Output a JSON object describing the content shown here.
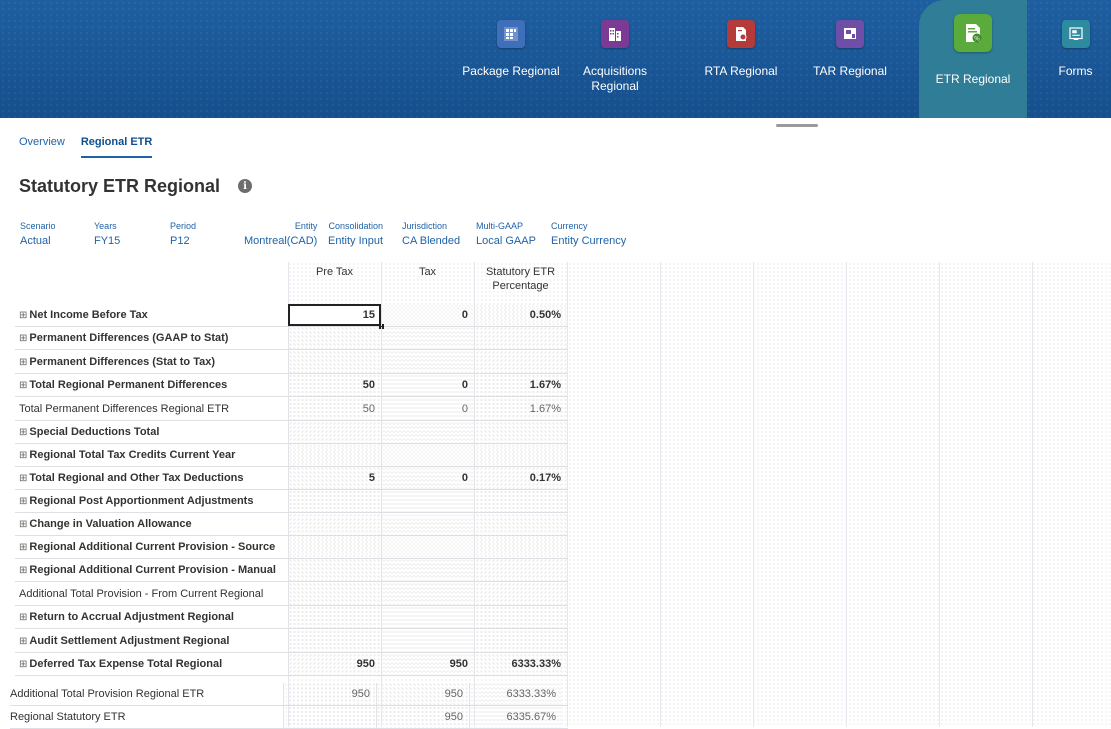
{
  "nav": {
    "items": [
      {
        "label": "Package Regional",
        "icon": "package-grid-icon",
        "color": "#3f6fb8"
      },
      {
        "label": "Acquisitions\nRegional",
        "icon": "building-icon",
        "color": "#7b3a93"
      },
      {
        "label": "RTA Regional",
        "icon": "rta-document-icon",
        "color": "#b53a3a"
      },
      {
        "label": "TAR Regional",
        "icon": "tar-report-icon",
        "color": "#6e4ea6"
      },
      {
        "label": "ETR Regional",
        "icon": "etr-percent-icon",
        "color": "#5aaa3c",
        "active": true
      },
      {
        "label": "Forms",
        "icon": "forms-icon",
        "color": "#2e8a9e"
      }
    ]
  },
  "tabs": [
    {
      "label": "Overview",
      "active": false
    },
    {
      "label": "Regional ETR",
      "active": true
    }
  ],
  "page_title": "Statutory ETR Regional",
  "pov": [
    {
      "label": "Scenario",
      "value": "Actual"
    },
    {
      "label": "Years",
      "value": "FY15"
    },
    {
      "label": "Period",
      "value": "P12"
    },
    {
      "label": "Entity",
      "value": "Montreal(CAD)"
    },
    {
      "label": "Consolidation",
      "value": "Entity Input"
    },
    {
      "label": "Jurisdiction",
      "value": "CA Blended"
    },
    {
      "label": "Multi-GAAP",
      "value": "Local GAAP"
    },
    {
      "label": "Currency",
      "value": "Entity Currency"
    }
  ],
  "columns": [
    "Pre Tax",
    "Tax",
    "Statutory ETR\nPercentage"
  ],
  "rows": [
    {
      "label": "Net Income Before Tax",
      "expand": true,
      "bold": true,
      "values": [
        "15",
        "0",
        "0.50%"
      ]
    },
    {
      "label": "Permanent Differences (GAAP to Stat)",
      "expand": true,
      "bold": true,
      "values": [
        "",
        "",
        ""
      ]
    },
    {
      "label": "Permanent Differences (Stat to Tax)",
      "expand": true,
      "bold": true,
      "values": [
        "",
        "",
        ""
      ]
    },
    {
      "label": "Total Regional Permanent Differences",
      "expand": true,
      "bold": true,
      "values": [
        "50",
        "0",
        "1.67%"
      ]
    },
    {
      "label": "Total Permanent Differences Regional ETR",
      "expand": false,
      "bold": false,
      "values": [
        "50",
        "0",
        "1.67%"
      ]
    },
    {
      "label": "Special Deductions Total",
      "expand": true,
      "bold": true,
      "values": [
        "",
        "",
        ""
      ]
    },
    {
      "label": "Regional Total Tax Credits Current Year",
      "expand": true,
      "bold": true,
      "values": [
        "",
        "",
        ""
      ]
    },
    {
      "label": "Total Regional and Other Tax Deductions",
      "expand": true,
      "bold": true,
      "values": [
        "5",
        "0",
        "0.17%"
      ]
    },
    {
      "label": "Regional Post Apportionment Adjustments",
      "expand": true,
      "bold": true,
      "values": [
        "",
        "",
        ""
      ]
    },
    {
      "label": "Change in Valuation Allowance",
      "expand": true,
      "bold": true,
      "values": [
        "",
        "",
        ""
      ]
    },
    {
      "label": "Regional Additional Current Provision - Source",
      "expand": true,
      "bold": true,
      "values": [
        "",
        "",
        ""
      ]
    },
    {
      "label": "Regional Additional Current Provision - Manual",
      "expand": true,
      "bold": true,
      "values": [
        "",
        "",
        ""
      ]
    },
    {
      "label": "Additional Total Provision - From Current Regional",
      "expand": false,
      "bold": false,
      "values": [
        "",
        "",
        ""
      ]
    },
    {
      "label": "Return to Accrual Adjustment Regional",
      "expand": true,
      "bold": true,
      "values": [
        "",
        "",
        ""
      ]
    },
    {
      "label": "Audit Settlement Adjustment Regional",
      "expand": true,
      "bold": true,
      "values": [
        "",
        "",
        ""
      ]
    },
    {
      "label": "Deferred Tax Expense Total Regional",
      "expand": true,
      "bold": true,
      "values": [
        "950",
        "950",
        "6333.33%"
      ]
    },
    {
      "label": "Additional Total Provision Regional ETR",
      "expand": false,
      "bold": false,
      "values": [
        "950",
        "950",
        "6333.33%"
      ]
    },
    {
      "label": "Regional Statutory ETR",
      "expand": false,
      "bold": false,
      "values": [
        "",
        "950",
        "6335.67%"
      ]
    }
  ],
  "expand_glyph": "⊞"
}
